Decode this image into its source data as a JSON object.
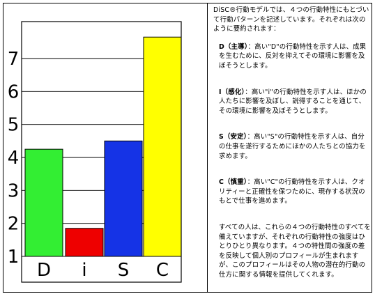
{
  "chart_data": {
    "type": "bar",
    "categories": [
      "D",
      "i",
      "S",
      "C"
    ],
    "values": [
      4.25,
      1.85,
      4.5,
      7.65
    ],
    "colors": [
      "#33ee33",
      "#ee0000",
      "#1533e6",
      "#ffff00"
    ],
    "yticks": [
      1,
      2,
      3,
      4,
      5,
      6,
      7
    ],
    "ylim": [
      1,
      8
    ],
    "grid": true
  },
  "description": {
    "intro": "DiSC®行動モデルでは、４つの行動特性にもとづいて行動パターンを記述しています。それぞれは次のように要約されます：",
    "items": [
      {
        "key": "D（主導）",
        "text": "：高い\"D\"の行動特性を示す人は、成果を生むために、反対を抑えてその環境に影響を及ぼそうとします。"
      },
      {
        "key": "I（感化）",
        "text": "：高い\"i\"の行動特性を示す人は、ほかの人たちに影響を及ぼし、説得することを通じて、その環境に影響を及ぼそうとします。"
      },
      {
        "key": "S（安定）",
        "text": "：高い\"S\"の行動特性を示す人は、自分の仕事を遂行するためにほかの人たちとの協力を求めます。"
      },
      {
        "key": "C（慎重）",
        "text": "：高い\"C\"の行動特性を示す人は、クオリティーと正確性を保つために、現存する状況のもとで仕事を進めます。"
      }
    ],
    "summary": "すべての人は、これらの４つの行動特性のすべてを備えていますが、それぞれの行動特性の強度はひとりひとり異なります。４つの特性間の強度の差を反映して個人別のプロフィールが生まれますが、このプロフィールはその人物の潜在的行動の仕方に関する情報を提供してくれます。"
  }
}
